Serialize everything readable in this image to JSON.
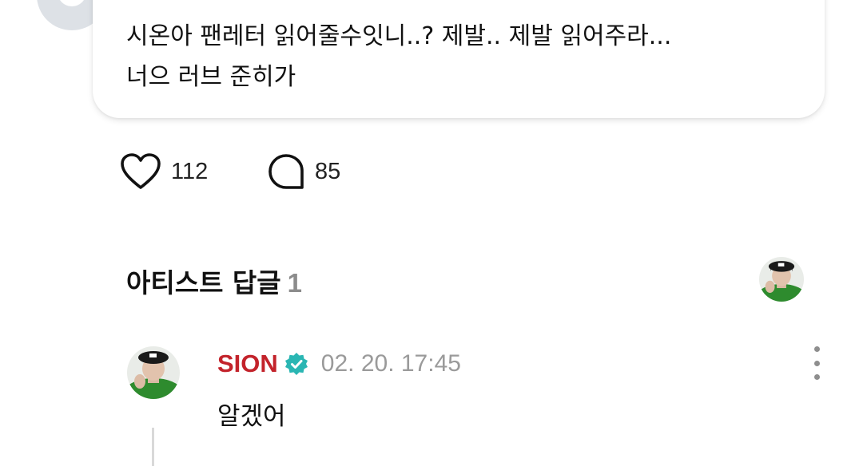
{
  "post": {
    "text_lines": [
      "시온아 팬레터 읽어줄수잇니..? 제발.. 제발 읽어주라...",
      "너으 러브 준히가"
    ]
  },
  "reactions": {
    "likes": "112",
    "comments": "85",
    "like_icon": "heart-icon",
    "comment_icon": "speech-bubble-icon"
  },
  "artist_replies": {
    "title": "아티스트 답글",
    "count": "1"
  },
  "reply": {
    "author": "SION",
    "verified_icon": "verified-badge-icon",
    "timestamp": "02. 20. 17:45",
    "text": "알겠어",
    "more_icon": "more-vertical-icon"
  },
  "colors": {
    "author": "#c3232b",
    "verified": "#2ab6b3",
    "meta": "#9a9a9a"
  }
}
